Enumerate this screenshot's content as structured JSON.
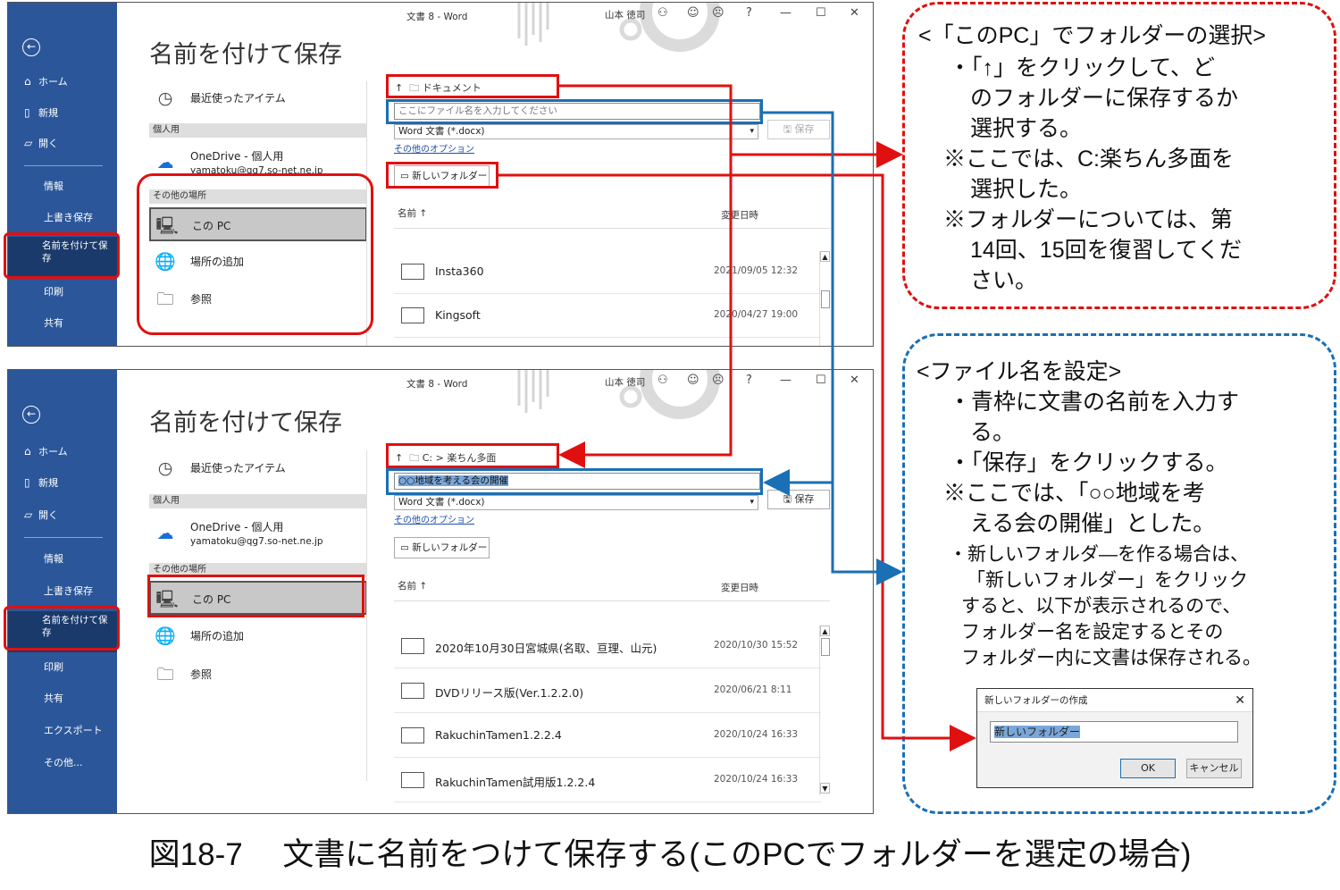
{
  "window": {
    "doc_title": "文書 8  -  Word",
    "user_name": "山本 徳司",
    "heading": "名前を付けて保存"
  },
  "nav": {
    "home": "ホーム",
    "new": "新規",
    "open": "開く",
    "info": "情報",
    "overwrite": "上書き保存",
    "save_as": "名前を付けて保存",
    "print": "印刷",
    "share": "共有",
    "export": "エクスポート",
    "more": "その他..."
  },
  "locations": {
    "recent": "最近使ったアイテム",
    "personal": "個人用",
    "onedrive": "OneDrive - 個人用",
    "onedrive_email": "yamatoku@qg7.so-net.ne.jp",
    "other": "その他の場所",
    "this_pc": "この PC",
    "add_place": "場所の追加",
    "browse": "参照"
  },
  "shot1": {
    "path": "ドキュメント",
    "filename_placeholder": "ここにファイル名を入力してください",
    "file_type": "Word 文書 (*.docx)",
    "save": "保存",
    "more_options": "その他のオプション",
    "new_folder": "新しいフォルダー",
    "col_name": "名前",
    "col_date": "変更日時",
    "files": [
      {
        "name": "Insta360",
        "date": "2021/09/05 12:32"
      },
      {
        "name": "Kingsoft",
        "date": "2020/04/27 19:00"
      }
    ]
  },
  "shot2": {
    "path": "C: > 楽ちん多面",
    "filename_value": "○○地域を考える会の開催",
    "file_type": "Word 文書 (*.docx)",
    "save": "保存",
    "more_options": "その他のオプション",
    "new_folder": "新しいフォルダー",
    "col_name": "名前",
    "col_date": "変更日時",
    "files": [
      {
        "name": "2020年10月30日宮城県(名取、亘理、山元)",
        "date": "2020/10/30 15:52"
      },
      {
        "name": "DVDリリース版(Ver.1.2.2.0)",
        "date": "2020/06/21 8:11"
      },
      {
        "name": "RakuchinTamen1.2.2.4",
        "date": "2020/10/24 16:33"
      },
      {
        "name": "RakuchinTamen試用版1.2.2.4",
        "date": "2020/10/24 16:33"
      }
    ]
  },
  "bubble1": {
    "lines": [
      "<「このPC」でフォルダーの選択>",
      "・「↑」をクリックして、ど",
      "のフォルダーに保存するか",
      "選択する。",
      "※ここでは、C:楽ちん多面を",
      "選択した。",
      "※フォルダーについては、第",
      "14回、15回を復習してくだ",
      "さい。"
    ]
  },
  "bubble2": {
    "lines": [
      "<ファイル名を設定>",
      "・青枠に文書の名前を入力す",
      "る。",
      "・「保存」をクリックする。",
      "※ここでは、「○○地域を考",
      "える会の開催」とした。",
      "・新しいフォルダ―を作る場合は、",
      "「新しいフォルダー」をクリック",
      "すると、以下が表示されるので、",
      "フォルダー名を設定するとその",
      "フォルダー内に文書は保存される。"
    ]
  },
  "dialog": {
    "title": "新しいフォルダーの作成",
    "value": "新しいフォルダー",
    "ok": "OK",
    "cancel": "キャンセル"
  },
  "caption": "図18-7　 文書に名前をつけて保存する(このPCでフォルダーを選定の場合)",
  "colors": {
    "sidebar": "#2b579a",
    "highlight_red": "#e01010",
    "highlight_blue": "#1a6fb5"
  }
}
